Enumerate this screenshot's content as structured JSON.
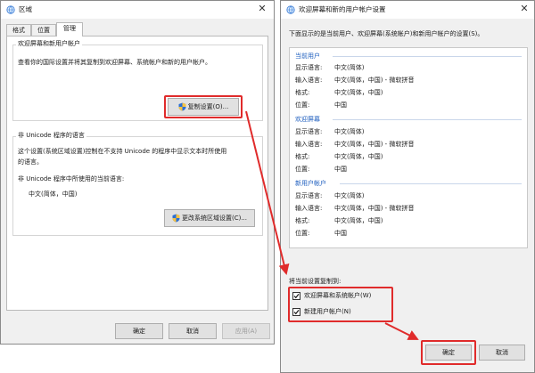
{
  "left_window": {
    "title": "区域",
    "tabs": [
      {
        "label": "格式",
        "active": false
      },
      {
        "label": "位置",
        "active": false
      },
      {
        "label": "管理",
        "active": true
      }
    ],
    "welcome_group": {
      "title": "欢迎屏幕和新用户帐户",
      "description": "查看你的国际设置并将其复制到欢迎屏幕、系统帐户和新的用户帐户。",
      "copy_button": "复制设置(O)..."
    },
    "unicode_group": {
      "title": "非 Unicode 程序的语言",
      "description_line1": "这个设置(系统区域设置)控制在不支持 Unicode 的程序中显示文本时所使用",
      "description_line2": "的语言。",
      "current_label": "非 Unicode 程序中所使用的当前语言:",
      "current_value": "中文(简体，中国)",
      "change_button": "更改系统区域设置(C)..."
    },
    "footer": {
      "ok": "确定",
      "cancel": "取消",
      "apply": "应用(A)"
    }
  },
  "right_window": {
    "title": "欢迎屏幕和新的用户帐户设置",
    "intro": "下面显示的是当前用户、欢迎屏幕(系统帐户)和新用户帐户的设置(S)。",
    "sections": [
      {
        "heading": "当前用户",
        "rows": [
          {
            "label": "显示语言:",
            "value": "中文(简体)"
          },
          {
            "label": "输入语言:",
            "value": "中文(简体，中国) - 微软拼音"
          },
          {
            "label": "格式:",
            "value": "中文(简体，中国)"
          },
          {
            "label": "位置:",
            "value": "中国"
          }
        ]
      },
      {
        "heading": "欢迎屏幕",
        "rows": [
          {
            "label": "显示语言:",
            "value": "中文(简体)"
          },
          {
            "label": "输入语言:",
            "value": "中文(简体，中国) - 微软拼音"
          },
          {
            "label": "格式:",
            "value": "中文(简体，中国)"
          },
          {
            "label": "位置:",
            "value": "中国"
          }
        ]
      },
      {
        "heading": "新用户帐户",
        "rows": [
          {
            "label": "显示语言:",
            "value": "中文(简体)"
          },
          {
            "label": "输入语言:",
            "value": "中文(简体，中国) - 微软拼音"
          },
          {
            "label": "格式:",
            "value": "中文(简体，中国)"
          },
          {
            "label": "位置:",
            "value": "中国"
          }
        ]
      }
    ],
    "copy_to_label": "将当前设置复制到:",
    "checkboxes": [
      {
        "label": "欢迎屏幕和系统帐户(W)",
        "checked": true
      },
      {
        "label": "新建用户帐户(N)",
        "checked": true
      }
    ],
    "footer": {
      "ok": "确定",
      "cancel": "取消"
    }
  },
  "colors": {
    "highlight": "#e02b2b",
    "section_heading": "#1f5fbf",
    "window_bg": "#f0f0f0"
  },
  "icons": {
    "uac_shield": "shield-icon",
    "window_close": "close-icon",
    "region_app": "globe-icon"
  }
}
